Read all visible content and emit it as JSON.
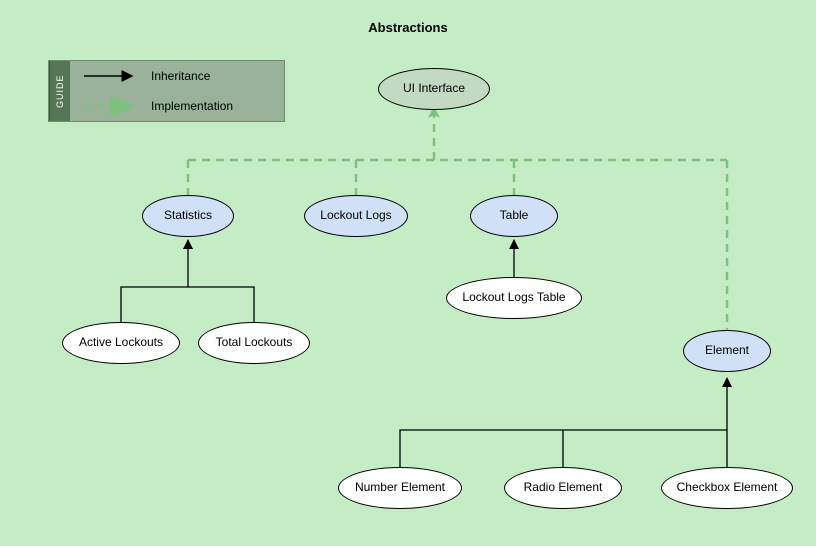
{
  "title": "Abstractions",
  "legend": {
    "tab": "GUIDE",
    "inheritance": "Inheritance",
    "implementation": "Implementation"
  },
  "nodes": {
    "ui_interface": "UI Interface",
    "statistics": "Statistics",
    "lockout_logs": "Lockout Logs",
    "table": "Table",
    "element": "Element",
    "active_lockouts": "Active Lockouts",
    "total_lockouts": "Total Lockouts",
    "lockout_logs_table": "Lockout Logs Table",
    "number_element": "Number Element",
    "radio_element": "Radio Element",
    "checkbox_element": "Checkbox Element"
  },
  "colors": {
    "implements_stroke": "#7fbf7f",
    "inherit_stroke": "#000000"
  },
  "chart_data": {
    "type": "diagram",
    "relationships": [
      {
        "from": "Statistics",
        "to": "UI Interface",
        "kind": "implements"
      },
      {
        "from": "Lockout Logs",
        "to": "UI Interface",
        "kind": "implements"
      },
      {
        "from": "Table",
        "to": "UI Interface",
        "kind": "implements"
      },
      {
        "from": "Element",
        "to": "UI Interface",
        "kind": "implements"
      },
      {
        "from": "Active Lockouts",
        "to": "Statistics",
        "kind": "inherits"
      },
      {
        "from": "Total Lockouts",
        "to": "Statistics",
        "kind": "inherits"
      },
      {
        "from": "Lockout Logs Table",
        "to": "Table",
        "kind": "inherits"
      },
      {
        "from": "Number Element",
        "to": "Element",
        "kind": "inherits"
      },
      {
        "from": "Radio Element",
        "to": "Element",
        "kind": "inherits"
      },
      {
        "from": "Checkbox Element",
        "to": "Element",
        "kind": "inherits"
      }
    ]
  }
}
